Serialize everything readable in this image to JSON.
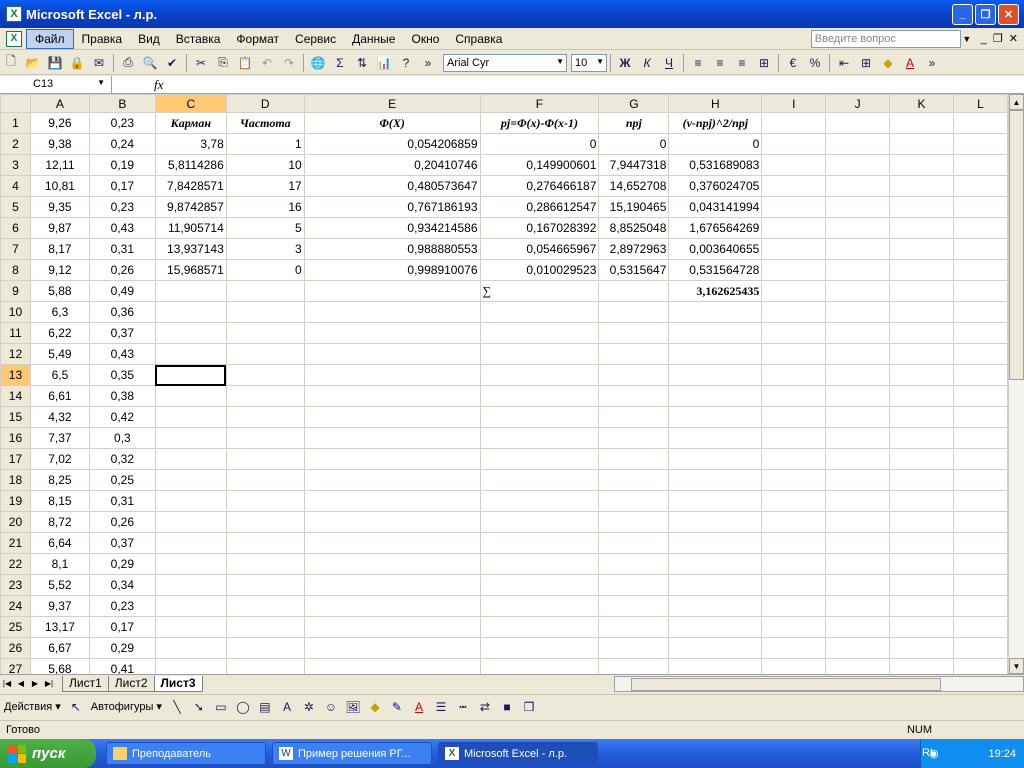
{
  "window": {
    "title": "Microsoft Excel - л.р."
  },
  "menu": {
    "items": [
      "Файл",
      "Правка",
      "Вид",
      "Вставка",
      "Формат",
      "Сервис",
      "Данные",
      "Окно",
      "Справка"
    ],
    "ask_placeholder": "Введите вопрос"
  },
  "toolbar": {
    "font": "Arial Cyr",
    "size": "10",
    "bold": "Ж",
    "italic": "К",
    "underline": "Ч",
    "percent": "%",
    "sigma": "Σ"
  },
  "formula": {
    "cell_ref": "C13",
    "fx_label": "fx",
    "value": ""
  },
  "columns": [
    "A",
    "B",
    "C",
    "D",
    "E",
    "F",
    "G",
    "H",
    "I",
    "J",
    "K",
    "L"
  ],
  "rows": [
    {
      "n": "1",
      "a": "9,26",
      "b": "0,23",
      "c": "Карман",
      "d": "Частота",
      "e": "Φ(X)",
      "f": "pj=Φ(x)-Φ(x-1)",
      "g": "npj",
      "h": "(v-npj)^2/npj"
    },
    {
      "n": "2",
      "a": "9,38",
      "b": "0,24",
      "c": "3,78",
      "d": "1",
      "e": "0,054206859",
      "f": "0",
      "g": "0",
      "h": "0"
    },
    {
      "n": "3",
      "a": "12,11",
      "b": "0,19",
      "c": "5,8114286",
      "d": "10",
      "e": "0,20410746",
      "f": "0,149900601",
      "g": "7,9447318",
      "h": "0,531689083"
    },
    {
      "n": "4",
      "a": "10,81",
      "b": "0,17",
      "c": "7,8428571",
      "d": "17",
      "e": "0,480573647",
      "f": "0,276466187",
      "g": "14,652708",
      "h": "0,376024705"
    },
    {
      "n": "5",
      "a": "9,35",
      "b": "0,23",
      "c": "9,8742857",
      "d": "16",
      "e": "0,767186193",
      "f": "0,286612547",
      "g": "15,190465",
      "h": "0,043141994"
    },
    {
      "n": "6",
      "a": "9,87",
      "b": "0,43",
      "c": "11,905714",
      "d": "5",
      "e": "0,934214586",
      "f": "0,167028392",
      "g": "8,8525048",
      "h": "1,676564269"
    },
    {
      "n": "7",
      "a": "8,17",
      "b": "0,31",
      "c": "13,937143",
      "d": "3",
      "e": "0,988880553",
      "f": "0,054665967",
      "g": "2,8972963",
      "h": "0,003640655"
    },
    {
      "n": "8",
      "a": "9,12",
      "b": "0,26",
      "c": "15,968571",
      "d": "0",
      "e": "0,998910076",
      "f": "0,010029523",
      "g": "0,5315647",
      "h": "0,531564728"
    },
    {
      "n": "9",
      "a": "5,88",
      "b": "0,49",
      "c": "",
      "d": "",
      "e": "",
      "f": "∑",
      "g": "",
      "h": "3,162625435"
    },
    {
      "n": "10",
      "a": "6,3",
      "b": "0,36",
      "c": "",
      "d": "",
      "e": "",
      "f": "",
      "g": "",
      "h": ""
    },
    {
      "n": "11",
      "a": "6,22",
      "b": "0,37",
      "c": "",
      "d": "",
      "e": "",
      "f": "",
      "g": "",
      "h": ""
    },
    {
      "n": "12",
      "a": "5,49",
      "b": "0,43",
      "c": "",
      "d": "",
      "e": "",
      "f": "",
      "g": "",
      "h": ""
    },
    {
      "n": "13",
      "a": "6,5",
      "b": "0,35",
      "c": "",
      "d": "",
      "e": "",
      "f": "",
      "g": "",
      "h": ""
    },
    {
      "n": "14",
      "a": "6,61",
      "b": "0,38",
      "c": "",
      "d": "",
      "e": "",
      "f": "",
      "g": "",
      "h": ""
    },
    {
      "n": "15",
      "a": "4,32",
      "b": "0,42",
      "c": "",
      "d": "",
      "e": "",
      "f": "",
      "g": "",
      "h": ""
    },
    {
      "n": "16",
      "a": "7,37",
      "b": "0,3",
      "c": "",
      "d": "",
      "e": "",
      "f": "",
      "g": "",
      "h": ""
    },
    {
      "n": "17",
      "a": "7,02",
      "b": "0,32",
      "c": "",
      "d": "",
      "e": "",
      "f": "",
      "g": "",
      "h": ""
    },
    {
      "n": "18",
      "a": "8,25",
      "b": "0,25",
      "c": "",
      "d": "",
      "e": "",
      "f": "",
      "g": "",
      "h": ""
    },
    {
      "n": "19",
      "a": "8,15",
      "b": "0,31",
      "c": "",
      "d": "",
      "e": "",
      "f": "",
      "g": "",
      "h": ""
    },
    {
      "n": "20",
      "a": "8,72",
      "b": "0,26",
      "c": "",
      "d": "",
      "e": "",
      "f": "",
      "g": "",
      "h": ""
    },
    {
      "n": "21",
      "a": "6,64",
      "b": "0,37",
      "c": "",
      "d": "",
      "e": "",
      "f": "",
      "g": "",
      "h": ""
    },
    {
      "n": "22",
      "a": "8,1",
      "b": "0,29",
      "c": "",
      "d": "",
      "e": "",
      "f": "",
      "g": "",
      "h": ""
    },
    {
      "n": "23",
      "a": "5,52",
      "b": "0,34",
      "c": "",
      "d": "",
      "e": "",
      "f": "",
      "g": "",
      "h": ""
    },
    {
      "n": "24",
      "a": "9,37",
      "b": "0,23",
      "c": "",
      "d": "",
      "e": "",
      "f": "",
      "g": "",
      "h": ""
    },
    {
      "n": "25",
      "a": "13,17",
      "b": "0,17",
      "c": "",
      "d": "",
      "e": "",
      "f": "",
      "g": "",
      "h": ""
    },
    {
      "n": "26",
      "a": "6,67",
      "b": "0,29",
      "c": "",
      "d": "",
      "e": "",
      "f": "",
      "g": "",
      "h": ""
    },
    {
      "n": "27",
      "a": "5,68",
      "b": "0,41",
      "c": "",
      "d": "",
      "e": "",
      "f": "",
      "g": "",
      "h": ""
    }
  ],
  "sheets": {
    "tabs": [
      "Лист1",
      "Лист2",
      "Лист3"
    ],
    "active": "Лист3"
  },
  "drawing": {
    "actions": "Действия",
    "autoshapes": "Автофигуры"
  },
  "status": {
    "text": "Готово",
    "num": "NUM"
  },
  "taskbar": {
    "start": "пуск",
    "items": [
      "Преподаватель",
      "Пример решения РГ...",
      "Microsoft Excel - л.р."
    ],
    "lang": "RL",
    "time": "19:24"
  },
  "colors": {
    "title_bar": "#0a3fc7",
    "selected_header": "#ffc873",
    "taskbar": "#245edb",
    "start": "#3a9a36"
  }
}
